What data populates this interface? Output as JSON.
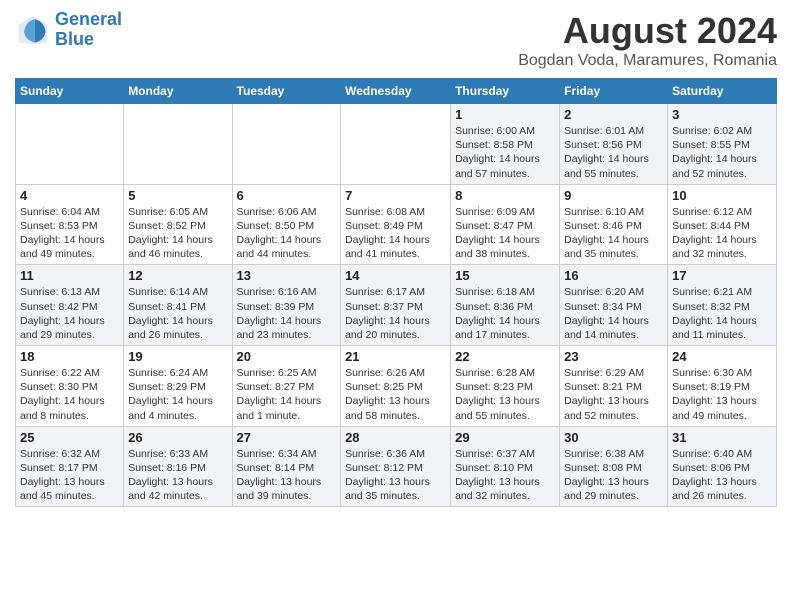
{
  "logo": {
    "line1": "General",
    "line2": "Blue"
  },
  "title": "August 2024",
  "subtitle": "Bogdan Voda, Maramures, Romania",
  "weekdays": [
    "Sunday",
    "Monday",
    "Tuesday",
    "Wednesday",
    "Thursday",
    "Friday",
    "Saturday"
  ],
  "rows": [
    [
      {
        "day": "",
        "content": ""
      },
      {
        "day": "",
        "content": ""
      },
      {
        "day": "",
        "content": ""
      },
      {
        "day": "",
        "content": ""
      },
      {
        "day": "1",
        "content": "Sunrise: 6:00 AM\nSunset: 8:58 PM\nDaylight: 14 hours\nand 57 minutes."
      },
      {
        "day": "2",
        "content": "Sunrise: 6:01 AM\nSunset: 8:56 PM\nDaylight: 14 hours\nand 55 minutes."
      },
      {
        "day": "3",
        "content": "Sunrise: 6:02 AM\nSunset: 8:55 PM\nDaylight: 14 hours\nand 52 minutes."
      }
    ],
    [
      {
        "day": "4",
        "content": "Sunrise: 6:04 AM\nSunset: 8:53 PM\nDaylight: 14 hours\nand 49 minutes."
      },
      {
        "day": "5",
        "content": "Sunrise: 6:05 AM\nSunset: 8:52 PM\nDaylight: 14 hours\nand 46 minutes."
      },
      {
        "day": "6",
        "content": "Sunrise: 6:06 AM\nSunset: 8:50 PM\nDaylight: 14 hours\nand 44 minutes."
      },
      {
        "day": "7",
        "content": "Sunrise: 6:08 AM\nSunset: 8:49 PM\nDaylight: 14 hours\nand 41 minutes."
      },
      {
        "day": "8",
        "content": "Sunrise: 6:09 AM\nSunset: 8:47 PM\nDaylight: 14 hours\nand 38 minutes."
      },
      {
        "day": "9",
        "content": "Sunrise: 6:10 AM\nSunset: 8:46 PM\nDaylight: 14 hours\nand 35 minutes."
      },
      {
        "day": "10",
        "content": "Sunrise: 6:12 AM\nSunset: 8:44 PM\nDaylight: 14 hours\nand 32 minutes."
      }
    ],
    [
      {
        "day": "11",
        "content": "Sunrise: 6:13 AM\nSunset: 8:42 PM\nDaylight: 14 hours\nand 29 minutes."
      },
      {
        "day": "12",
        "content": "Sunrise: 6:14 AM\nSunset: 8:41 PM\nDaylight: 14 hours\nand 26 minutes."
      },
      {
        "day": "13",
        "content": "Sunrise: 6:16 AM\nSunset: 8:39 PM\nDaylight: 14 hours\nand 23 minutes."
      },
      {
        "day": "14",
        "content": "Sunrise: 6:17 AM\nSunset: 8:37 PM\nDaylight: 14 hours\nand 20 minutes."
      },
      {
        "day": "15",
        "content": "Sunrise: 6:18 AM\nSunset: 8:36 PM\nDaylight: 14 hours\nand 17 minutes."
      },
      {
        "day": "16",
        "content": "Sunrise: 6:20 AM\nSunset: 8:34 PM\nDaylight: 14 hours\nand 14 minutes."
      },
      {
        "day": "17",
        "content": "Sunrise: 6:21 AM\nSunset: 8:32 PM\nDaylight: 14 hours\nand 11 minutes."
      }
    ],
    [
      {
        "day": "18",
        "content": "Sunrise: 6:22 AM\nSunset: 8:30 PM\nDaylight: 14 hours\nand 8 minutes."
      },
      {
        "day": "19",
        "content": "Sunrise: 6:24 AM\nSunset: 8:29 PM\nDaylight: 14 hours\nand 4 minutes."
      },
      {
        "day": "20",
        "content": "Sunrise: 6:25 AM\nSunset: 8:27 PM\nDaylight: 14 hours\nand 1 minute."
      },
      {
        "day": "21",
        "content": "Sunrise: 6:26 AM\nSunset: 8:25 PM\nDaylight: 13 hours\nand 58 minutes."
      },
      {
        "day": "22",
        "content": "Sunrise: 6:28 AM\nSunset: 8:23 PM\nDaylight: 13 hours\nand 55 minutes."
      },
      {
        "day": "23",
        "content": "Sunrise: 6:29 AM\nSunset: 8:21 PM\nDaylight: 13 hours\nand 52 minutes."
      },
      {
        "day": "24",
        "content": "Sunrise: 6:30 AM\nSunset: 8:19 PM\nDaylight: 13 hours\nand 49 minutes."
      }
    ],
    [
      {
        "day": "25",
        "content": "Sunrise: 6:32 AM\nSunset: 8:17 PM\nDaylight: 13 hours\nand 45 minutes."
      },
      {
        "day": "26",
        "content": "Sunrise: 6:33 AM\nSunset: 8:16 PM\nDaylight: 13 hours\nand 42 minutes."
      },
      {
        "day": "27",
        "content": "Sunrise: 6:34 AM\nSunset: 8:14 PM\nDaylight: 13 hours\nand 39 minutes."
      },
      {
        "day": "28",
        "content": "Sunrise: 6:36 AM\nSunset: 8:12 PM\nDaylight: 13 hours\nand 35 minutes."
      },
      {
        "day": "29",
        "content": "Sunrise: 6:37 AM\nSunset: 8:10 PM\nDaylight: 13 hours\nand 32 minutes."
      },
      {
        "day": "30",
        "content": "Sunrise: 6:38 AM\nSunset: 8:08 PM\nDaylight: 13 hours\nand 29 minutes."
      },
      {
        "day": "31",
        "content": "Sunrise: 6:40 AM\nSunset: 8:06 PM\nDaylight: 13 hours\nand 26 minutes."
      }
    ]
  ]
}
